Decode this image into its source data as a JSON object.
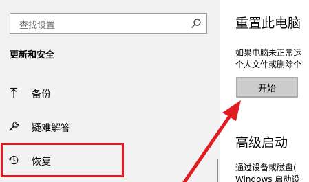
{
  "search": {
    "placeholder": "查找设置"
  },
  "sidebar": {
    "section_title": "更新和安全",
    "items": [
      {
        "label": "备份",
        "icon": "backup-arrow-icon"
      },
      {
        "label": "疑难解答",
        "icon": "wrench-icon"
      },
      {
        "label": "恢复",
        "icon": "history-icon"
      }
    ]
  },
  "reset": {
    "title": "重置此电脑",
    "desc_line1": "如果电脑未正常运",
    "desc_line2": "个人文件或删除个",
    "button_label": "开始"
  },
  "advanced": {
    "title": "高级启动",
    "desc_line1": "通过设备或磁盘(",
    "desc_line2": "Windows 启动设"
  },
  "annotation": {
    "color": "#e01b22"
  }
}
